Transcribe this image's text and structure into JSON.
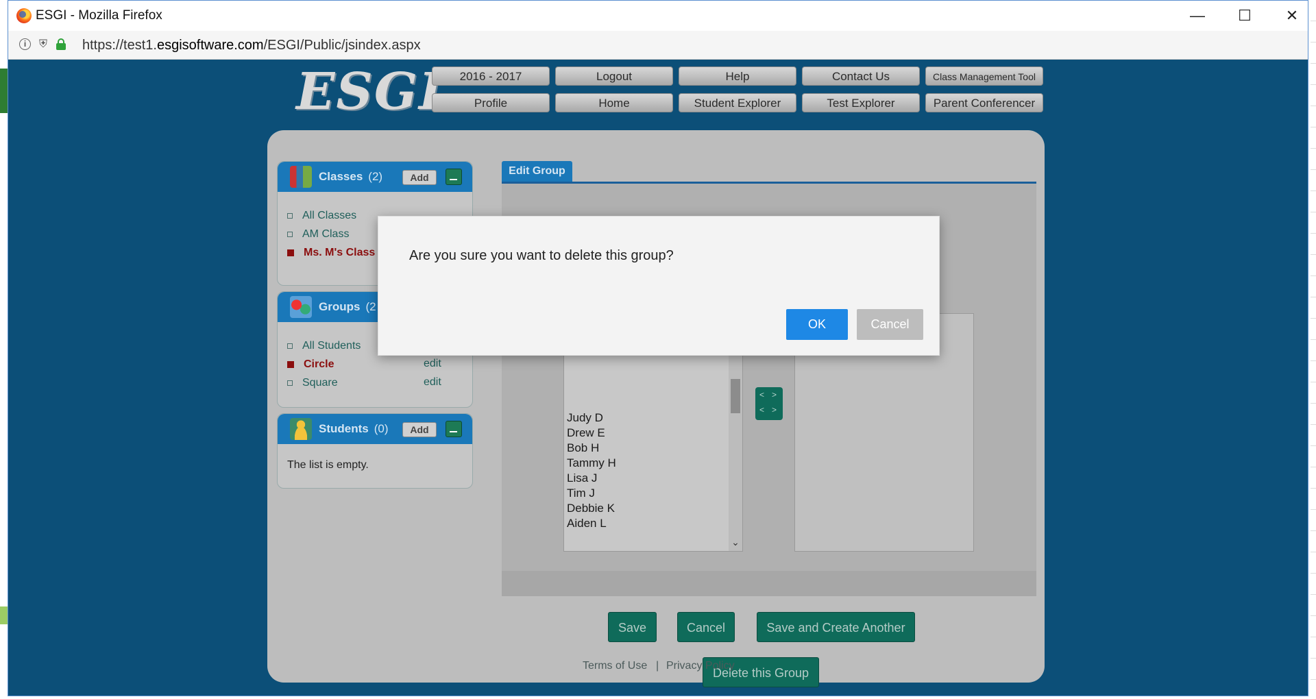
{
  "browser": {
    "title": "ESGI - Mozilla Firefox",
    "url_prefix": "https://test1.",
    "url_domain": "esgisoftware.com",
    "url_path": "/ESGI/Public/jsindex.aspx"
  },
  "app": {
    "logo_text": "ESGI",
    "nav_row1": [
      "2016 - 2017",
      "Logout",
      "Help",
      "Contact Us",
      "Class Management Tool"
    ],
    "nav_row2": [
      "Profile",
      "Home",
      "Student Explorer",
      "Test Explorer",
      "Parent Conferencer"
    ]
  },
  "sidebar": {
    "classes": {
      "title": "Classes",
      "count": "(2)",
      "add_label": "Add",
      "items": [
        "All Classes",
        "AM Class",
        "Ms. M's Class"
      ],
      "selected_index": 2
    },
    "groups": {
      "title": "Groups",
      "count": "(2",
      "items": [
        "All Students",
        "Circle",
        "Square"
      ],
      "edit_label": "edit",
      "selected_index": 1
    },
    "students": {
      "title": "Students",
      "count": "(0)",
      "add_label": "Add",
      "empty_text": "The list is empty."
    }
  },
  "main": {
    "tab_label": "Edit Group",
    "student_list": [
      "Judy D",
      "Drew E",
      "Bob H",
      "Tammy H",
      "Lisa J",
      "Tim J",
      "Debbie K",
      "Aiden L"
    ],
    "buttons": {
      "save": "Save",
      "cancel": "Cancel",
      "save_create": "Save and Create Another",
      "delete": "Delete this Group"
    }
  },
  "footer": {
    "terms": "Terms of Use",
    "separator": "|",
    "privacy": "Privacy Policy"
  },
  "dialog": {
    "message": "Are you sure you want to delete this group?",
    "ok_label": "OK",
    "cancel_label": "Cancel"
  }
}
